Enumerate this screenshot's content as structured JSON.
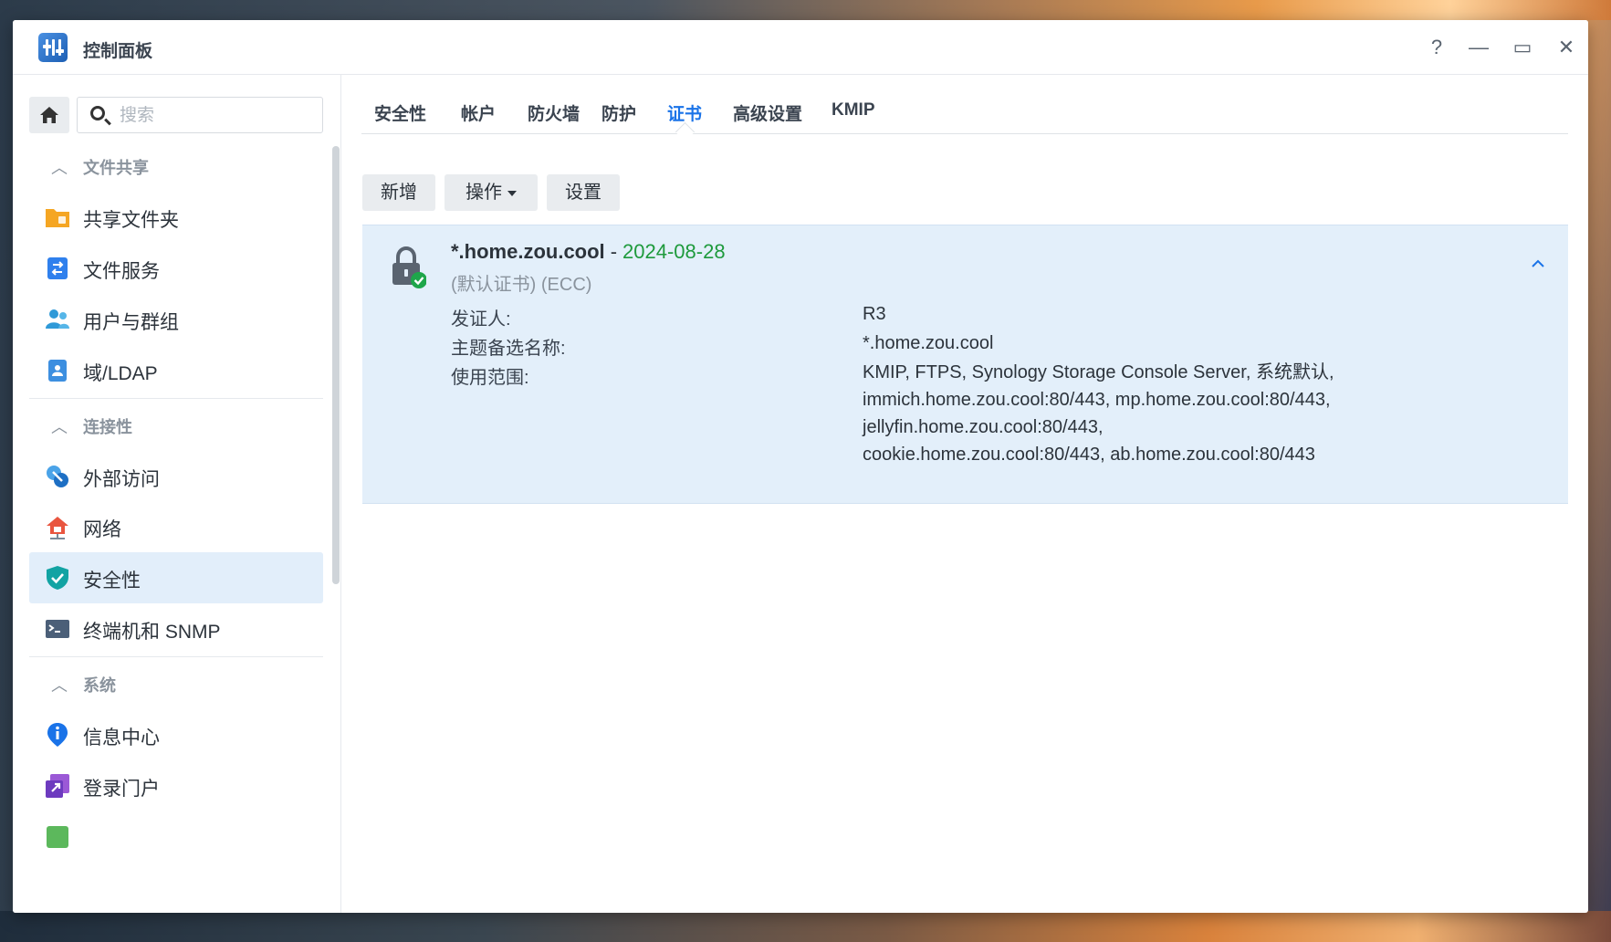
{
  "window": {
    "title": "控制面板"
  },
  "controls": {
    "help": "?",
    "minimize": "—",
    "maximize": "▭",
    "close": "✕"
  },
  "search": {
    "placeholder": "搜索"
  },
  "sidebar": {
    "sections": [
      {
        "label": "文件共享",
        "items": [
          "共享文件夹",
          "文件服务",
          "用户与群组",
          "域/LDAP"
        ]
      },
      {
        "label": "连接性",
        "items": [
          "外部访问",
          "网络",
          "安全性",
          "终端机和 SNMP"
        ]
      },
      {
        "label": "系统",
        "items": [
          "信息中心",
          "登录门户"
        ]
      }
    ],
    "active_item": "安全性"
  },
  "tabs": [
    "安全性",
    "帐户",
    "防火墙",
    "防护",
    "证书",
    "高级设置",
    "KMIP"
  ],
  "active_tab": "证书",
  "toolbar": {
    "add": "新增",
    "action": "操作",
    "settings": "设置"
  },
  "certificate": {
    "domain": "*.home.zou.cool",
    "separator": "-",
    "expiry": "2024-08-28",
    "meta": "(默认证书) (ECC)",
    "issuer_label": "发证人:",
    "issuer": "R3",
    "san_label": "主题备选名称:",
    "san": "*.home.zou.cool",
    "usage_label": "使用范围:",
    "usage_lines": [
      "KMIP, FTPS, Synology Storage Console Server, 系统默认,",
      "immich.home.zou.cool:80/443, mp.home.zou.cool:80/443,",
      "jellyfin.home.zou.cool:80/443,",
      "cookie.home.zou.cool:80/443, ab.home.zou.cool:80/443"
    ]
  },
  "colors": {
    "accent": "#1a73e8",
    "date": "#1e9a3c",
    "active_bg": "#e2eefa"
  }
}
